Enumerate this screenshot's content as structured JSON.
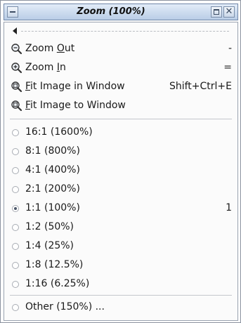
{
  "window": {
    "title": "Zoom (100%)"
  },
  "menu": {
    "actions": [
      {
        "pre": "Zoom ",
        "mn": "O",
        "post": "ut",
        "accel": "-",
        "icon": "zoom-out-icon"
      },
      {
        "pre": "Zoom ",
        "mn": "I",
        "post": "n",
        "accel": "=",
        "icon": "zoom-in-icon"
      },
      {
        "pre": "",
        "mn": "F",
        "post": "it Image in Window",
        "accel": "Shift+Ctrl+E",
        "icon": "zoom-fit-icon"
      },
      {
        "pre": "",
        "mn": "F",
        "post": "it Image to Window",
        "accel": "",
        "icon": "zoom-fit-icon"
      }
    ],
    "ratios": [
      {
        "label": "16:1  (1600%)",
        "checked": false,
        "accel": ""
      },
      {
        "label": "8:1  (800%)",
        "checked": false,
        "accel": ""
      },
      {
        "label": "4:1  (400%)",
        "checked": false,
        "accel": ""
      },
      {
        "label": "2:1  (200%)",
        "checked": false,
        "accel": ""
      },
      {
        "label": "1:1  (100%)",
        "checked": true,
        "accel": "1"
      },
      {
        "label": "1:2  (50%)",
        "checked": false,
        "accel": ""
      },
      {
        "label": "1:4  (25%)",
        "checked": false,
        "accel": ""
      },
      {
        "label": "1:8  (12.5%)",
        "checked": false,
        "accel": ""
      },
      {
        "label": "1:16  (6.25%)",
        "checked": false,
        "accel": ""
      }
    ],
    "other": {
      "label": "Other (150%) ...",
      "checked": false
    }
  },
  "colors": {
    "titlebar_top": "#e2ecf8",
    "titlebar_bottom": "#b9cde6",
    "radio_dot": "#4b5668"
  }
}
